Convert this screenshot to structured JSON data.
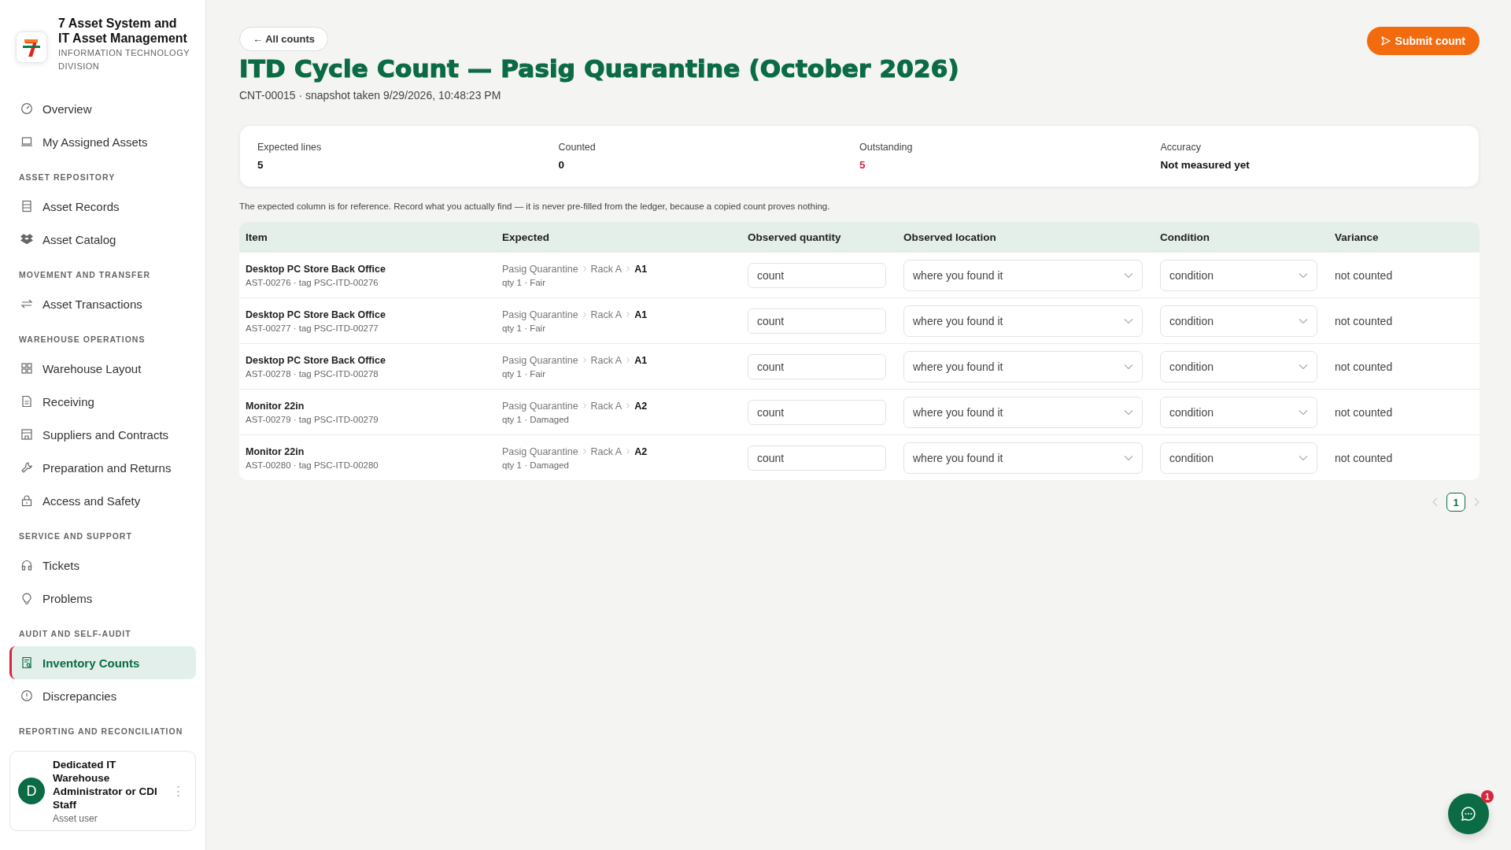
{
  "sidebar": {
    "brand": {
      "title": "7 Asset System and IT Asset Management",
      "subtitle": "INFORMATION TECHNOLOGY DIVISION"
    },
    "sections": [
      {
        "items": [
          {
            "label": "Overview",
            "selected": false
          },
          {
            "label": "My Assigned Assets",
            "selected": false
          }
        ]
      },
      {
        "heading": "ASSET REPOSITORY",
        "items": [
          {
            "label": "Asset Records",
            "selected": false
          },
          {
            "label": "Asset Catalog",
            "selected": false
          }
        ]
      },
      {
        "heading": "MOVEMENT AND TRANSFER",
        "items": [
          {
            "label": "Asset Transactions",
            "selected": false
          }
        ]
      },
      {
        "heading": "WAREHOUSE OPERATIONS",
        "items": [
          {
            "label": "Warehouse Layout",
            "selected": false
          },
          {
            "label": "Receiving",
            "selected": false
          },
          {
            "label": "Suppliers and Contracts",
            "selected": false
          },
          {
            "label": "Preparation and Returns",
            "selected": false
          },
          {
            "label": "Access and Safety",
            "selected": false
          }
        ]
      },
      {
        "heading": "SERVICE AND SUPPORT",
        "items": [
          {
            "label": "Tickets",
            "selected": false
          },
          {
            "label": "Problems",
            "selected": false
          }
        ]
      },
      {
        "heading": "AUDIT AND SELF-AUDIT",
        "items": [
          {
            "label": "Inventory Counts",
            "selected": true
          },
          {
            "label": "Discrepancies",
            "selected": false
          }
        ]
      },
      {
        "heading": "REPORTING AND RECONCILIATION"
      }
    ],
    "user": {
      "initial": "D",
      "name": "Dedicated IT Warehouse Administrator or CDI Staff",
      "role": "Asset user",
      "menu": "⋮"
    }
  },
  "header": {
    "back": "← All counts",
    "title": "ITD Cycle Count — Pasig Quarantine (October 2026)",
    "subtitle": "CNT-00015 · snapshot taken 9/29/2026, 10:48:23 PM",
    "submit": "Submit count"
  },
  "stats": [
    {
      "label": "Expected lines",
      "value": "5",
      "alert": false
    },
    {
      "label": "Counted",
      "value": "0",
      "alert": false
    },
    {
      "label": "Outstanding",
      "value": "5",
      "alert": true
    },
    {
      "label": "Accuracy",
      "value": "Not measured yet",
      "alert": false
    }
  ],
  "note": "The expected column is for reference. Record what you actually find — it is never pre-filled from the ledger, because a copied count proves nothing.",
  "table": {
    "columns": [
      "Item",
      "Expected",
      "Observed quantity",
      "Observed location",
      "Condition",
      "Variance"
    ],
    "rows": [
      {
        "name": "Desktop PC Store Back Office",
        "sub": "AST-00276 · tag PSC-ITD-00276",
        "location": [
          "Pasig Quarantine",
          "Rack A",
          "A1"
        ],
        "expected": "qty 1 · Fair",
        "quantity_placeholder": "count",
        "location_placeholder": "where you found it",
        "condition_placeholder": "condition",
        "variance": "not counted"
      },
      {
        "name": "Desktop PC Store Back Office",
        "sub": "AST-00277 · tag PSC-ITD-00277",
        "location": [
          "Pasig Quarantine",
          "Rack A",
          "A1"
        ],
        "expected": "qty 1 · Fair",
        "quantity_placeholder": "count",
        "location_placeholder": "where you found it",
        "condition_placeholder": "condition",
        "variance": "not counted"
      },
      {
        "name": "Desktop PC Store Back Office",
        "sub": "AST-00278 · tag PSC-ITD-00278",
        "location": [
          "Pasig Quarantine",
          "Rack A",
          "A1"
        ],
        "expected": "qty 1 · Fair",
        "quantity_placeholder": "count",
        "location_placeholder": "where you found it",
        "condition_placeholder": "condition",
        "variance": "not counted"
      },
      {
        "name": "Monitor 22in",
        "sub": "AST-00279 · tag PSC-ITD-00279",
        "location": [
          "Pasig Quarantine",
          "Rack A",
          "A2"
        ],
        "expected": "qty 1 · Damaged",
        "quantity_placeholder": "count",
        "location_placeholder": "where you found it",
        "condition_placeholder": "condition",
        "variance": "not counted"
      },
      {
        "name": "Monitor 22in",
        "sub": "AST-00280 · tag PSC-ITD-00280",
        "location": [
          "Pasig Quarantine",
          "Rack A",
          "A2"
        ],
        "expected": "qty 1 · Damaged",
        "quantity_placeholder": "count",
        "location_placeholder": "where you found it",
        "condition_placeholder": "condition",
        "variance": "not counted"
      }
    ]
  },
  "pagination": {
    "pages": [
      {
        "label": "1",
        "selected": true
      }
    ],
    "prev_disabled": true,
    "next_disabled": true
  },
  "chat": {
    "badge": "1"
  }
}
